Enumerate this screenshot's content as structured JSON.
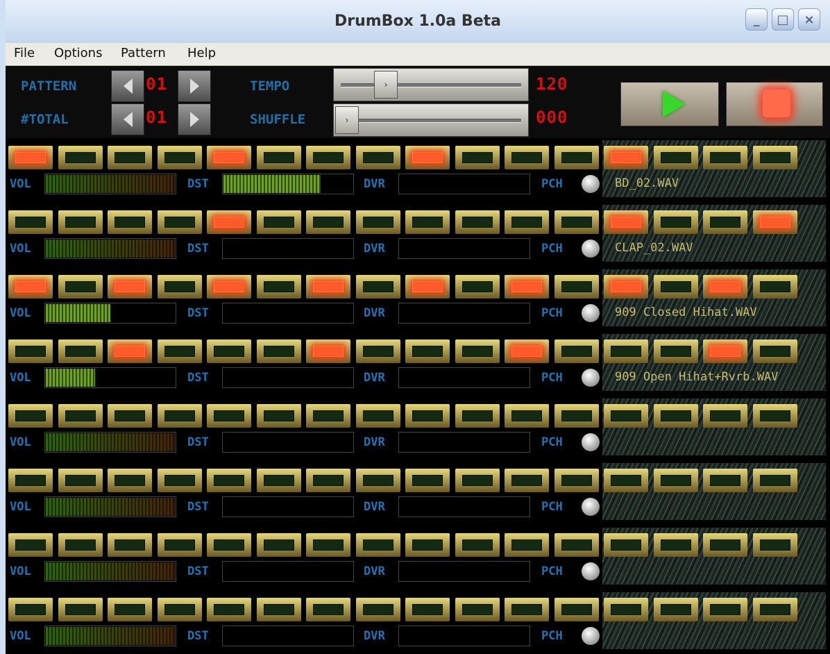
{
  "window": {
    "title": "DrumBox 1.0a Beta"
  },
  "menu": [
    "File",
    "Options",
    "Pattern",
    "Help"
  ],
  "controls": {
    "pattern_label": "PATTERN",
    "pattern_value": "01",
    "total_label": "#TOTAL",
    "total_value": "01",
    "tempo_label": "TEMPO",
    "tempo_value": "120",
    "shuffle_label": "SHUFFLE",
    "shuffle_value": "000"
  },
  "track_labels": {
    "vol": "VOL",
    "dst": "DST",
    "dvr": "DVR",
    "pch": "PCH"
  },
  "tracks": [
    {
      "sample": "BD_02.WAV",
      "steps": [
        1,
        0,
        0,
        0,
        1,
        0,
        0,
        0,
        1,
        0,
        0,
        0,
        1,
        0,
        0,
        0
      ],
      "vol": 1.0,
      "dst": 0.75,
      "dvr": 0
    },
    {
      "sample": "CLAP_02.WAV",
      "steps": [
        0,
        0,
        0,
        0,
        1,
        0,
        0,
        0,
        0,
        0,
        0,
        0,
        1,
        0,
        0,
        1
      ],
      "vol": 1.0,
      "dst": 0,
      "dvr": 0
    },
    {
      "sample": "909 Closed Hihat.WAV",
      "steps": [
        1,
        0,
        1,
        0,
        1,
        0,
        1,
        0,
        1,
        0,
        1,
        0,
        1,
        0,
        1,
        0
      ],
      "vol": 0.5,
      "dst": 0,
      "dvr": 0
    },
    {
      "sample": "909 Open Hihat+Rvrb.WAV",
      "steps": [
        0,
        0,
        1,
        0,
        0,
        0,
        1,
        0,
        0,
        0,
        1,
        0,
        0,
        0,
        1,
        0
      ],
      "vol": 0.38,
      "dst": 0,
      "dvr": 0
    },
    {
      "sample": "",
      "steps": [
        0,
        0,
        0,
        0,
        0,
        0,
        0,
        0,
        0,
        0,
        0,
        0,
        0,
        0,
        0,
        0
      ],
      "vol": 1.0,
      "dst": 0,
      "dvr": 0
    },
    {
      "sample": "",
      "steps": [
        0,
        0,
        0,
        0,
        0,
        0,
        0,
        0,
        0,
        0,
        0,
        0,
        0,
        0,
        0,
        0
      ],
      "vol": 1.0,
      "dst": 0,
      "dvr": 0
    },
    {
      "sample": "",
      "steps": [
        0,
        0,
        0,
        0,
        0,
        0,
        0,
        0,
        0,
        0,
        0,
        0,
        0,
        0,
        0,
        0
      ],
      "vol": 1.0,
      "dst": 0,
      "dvr": 0
    },
    {
      "sample": "",
      "steps": [
        0,
        0,
        0,
        0,
        0,
        0,
        0,
        0,
        0,
        0,
        0,
        0,
        0,
        0,
        0,
        0
      ],
      "vol": 1.0,
      "dst": 0,
      "dvr": 0
    }
  ]
}
